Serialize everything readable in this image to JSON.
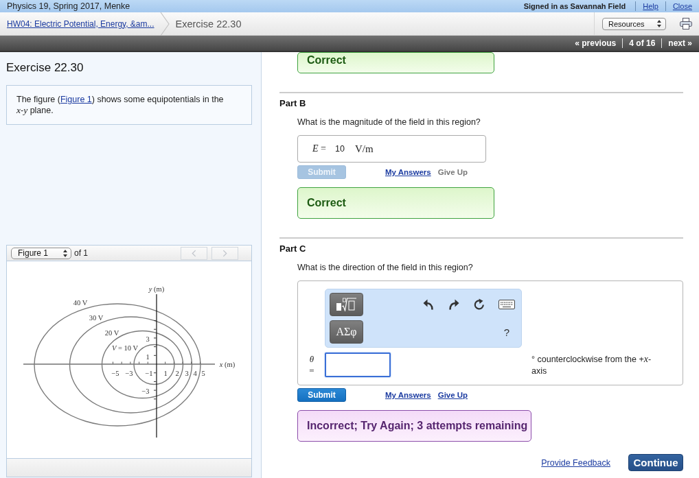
{
  "header": {
    "course": "Physics 19, Spring 2017, Menke",
    "signed_in": "Signed in as Savannah Field",
    "links": [
      "Help",
      "Close"
    ]
  },
  "breadcrumb": {
    "assignment": "HW04: Electric Potential, Energy, &am...",
    "current": "Exercise 22.30",
    "resources": "Resources"
  },
  "pager": {
    "previous": "« previous",
    "position": "4 of 16",
    "next": "next »"
  },
  "problem": {
    "title": "Exercise 22.30",
    "statement_before": "The figure (",
    "statement_link": "Figure 1",
    "statement_after": ") shows some equipotentials in the *x*-*y* plane."
  },
  "figure_panel": {
    "select": "Figure 1",
    "count": "of 1",
    "nav": [
      {
        "kind": "previous",
        "disabled": true
      },
      {
        "kind": "next",
        "disabled": true
      }
    ],
    "figure": {
      "x_axis": "*x* (m)",
      "y_axis": "*y* (m)",
      "x_ticks": [
        "−5",
        "−3",
        "−1",
        "1",
        "2",
        "3",
        "4",
        "5"
      ],
      "y_ticks": [
        "3",
        "1",
        "−3"
      ],
      "equipotentials": [
        {
          "label": "40 V"
        },
        {
          "label": "30 V"
        },
        {
          "label": "20 V"
        },
        {
          "label": "*V* = 10 V"
        }
      ]
    }
  },
  "part_a_feedback": {
    "kind": "correct",
    "text": "Correct"
  },
  "parts": [
    {
      "title": "Part B",
      "question": "What is the magnitude of the field in this region?",
      "kind": "value",
      "answer": {
        "label": "*E* =",
        "value": "10",
        "unit": "V/m"
      },
      "submit": {
        "label": "Submit",
        "disabled": true
      },
      "links": [
        {
          "label": "My Answers",
          "disabled": false
        },
        {
          "label": "Give Up",
          "disabled": true
        }
      ],
      "feedback": {
        "kind": "correct",
        "text": "Correct"
      }
    },
    {
      "title": "Part C",
      "question": "What is the direction of the field in this region?",
      "kind": "math_input",
      "answer": {
        "label": "*θ* =",
        "focused": true,
        "unit": "° counterclockwise from the +*x*-axis",
        "toolbar": {
          "buttons": [
            {
              "kind": "templates"
            },
            {
              "kind": "symbols",
              "label": "ΑΣφ"
            }
          ],
          "actions": [
            {
              "kind": "undo"
            },
            {
              "kind": "redo"
            },
            {
              "kind": "reset"
            },
            {
              "kind": "keyboard"
            }
          ],
          "help": "?"
        }
      },
      "submit": {
        "label": "Submit",
        "disabled": false
      },
      "links": [
        {
          "label": "My Answers",
          "disabled": false
        },
        {
          "label": "Give Up",
          "disabled": false
        }
      ],
      "feedback": {
        "kind": "incorrect",
        "text": "Incorrect; Try Again; 3 attempts remaining"
      }
    }
  ],
  "footer": {
    "feedback_link": "Provide Feedback",
    "continue": "Continue"
  }
}
